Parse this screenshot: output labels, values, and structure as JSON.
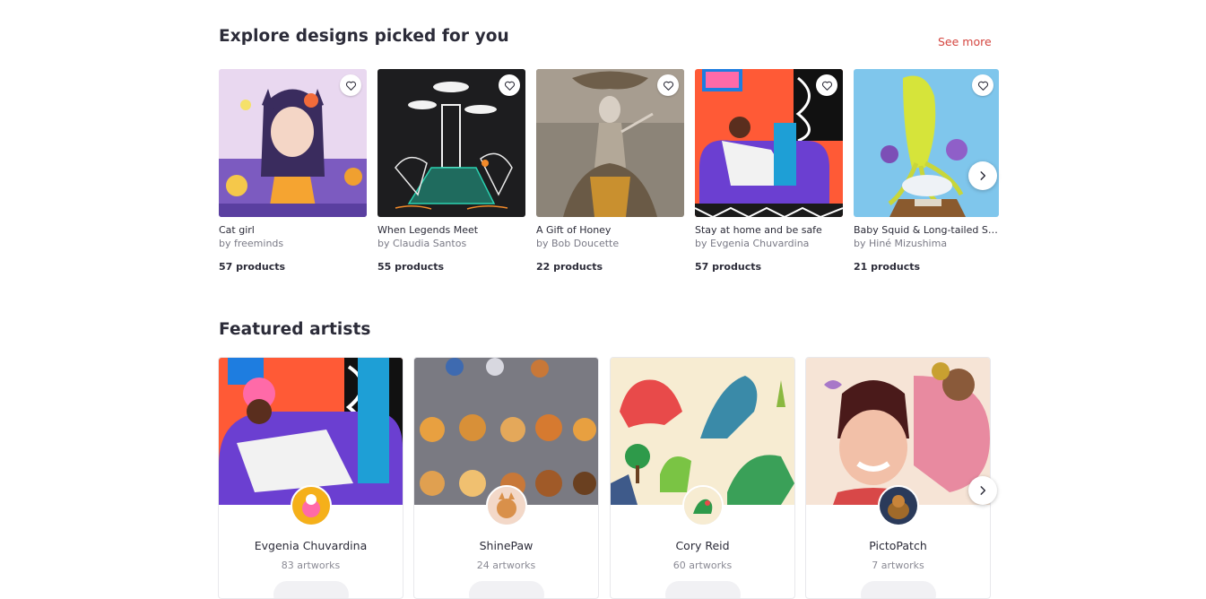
{
  "explore": {
    "title": "Explore designs picked for you",
    "see_more": "See more",
    "designs": [
      {
        "title": "Cat girl",
        "artist": "by freeminds",
        "products": "57 products"
      },
      {
        "title": "When Legends Meet",
        "artist": "by Claudia Santos",
        "products": "55 products"
      },
      {
        "title": "A Gift of Honey",
        "artist": "by Bob Doucette",
        "products": "22 products"
      },
      {
        "title": "Stay at home and be safe",
        "artist": "by Evgenia Chuvardina",
        "products": "57 products"
      },
      {
        "title": "Baby Squid & Long-tailed Se...",
        "artist": "by Hiné Mizushima",
        "products": "21 products"
      }
    ],
    "next_icon": "chevron-right-icon",
    "heart_icon": "heart-outline-icon"
  },
  "featured": {
    "title": "Featured artists",
    "artists": [
      {
        "name": "Evgenia Chuvardina",
        "count": "83 artworks"
      },
      {
        "name": "ShinePaw",
        "count": "24 artworks"
      },
      {
        "name": "Cory Reid",
        "count": "60 artworks"
      },
      {
        "name": "PictoPatch",
        "count": "7 artworks"
      }
    ],
    "next_icon": "chevron-right-icon"
  },
  "colors": {
    "accent": "#d4453f",
    "title_text": "#2b2b38",
    "muted_text": "#7a7a86"
  }
}
